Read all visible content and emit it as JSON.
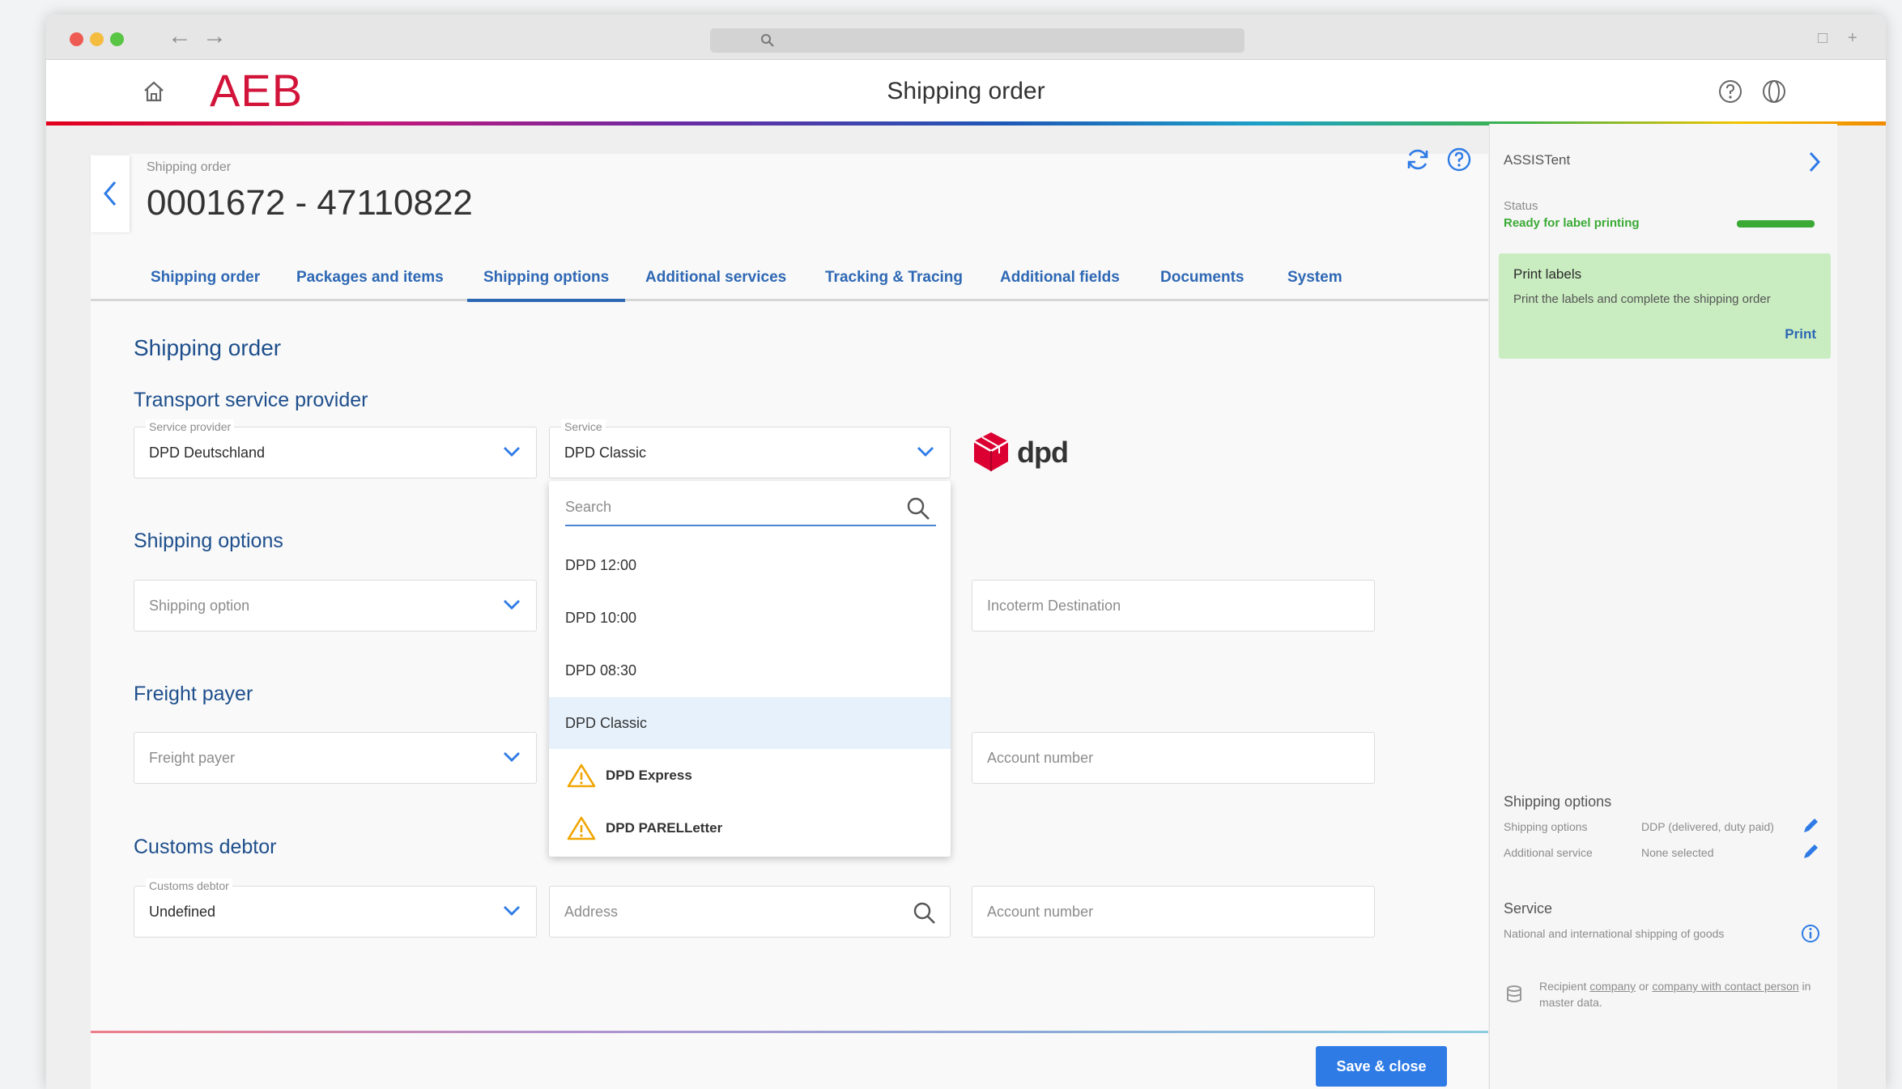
{
  "window": {
    "app_title": "Shipping order",
    "logo_text": "AEB"
  },
  "header": {
    "subtitle": "Shipping order",
    "order_number": "0001672 - 47110822"
  },
  "tabs": [
    {
      "label": "Shipping order"
    },
    {
      "label": "Packages and items"
    },
    {
      "label": "Shipping options",
      "active": true
    },
    {
      "label": "Additional services"
    },
    {
      "label": "Tracking & Tracing"
    },
    {
      "label": "Additional fields"
    },
    {
      "label": "Documents"
    },
    {
      "label": "System"
    }
  ],
  "form": {
    "section_title": "Shipping order",
    "transport": {
      "title": "Transport service provider",
      "provider_label": "Service provider",
      "provider_value": "DPD Deutschland",
      "service_label": "Service",
      "service_value": "DPD Classic",
      "carrier_logo": "dpd"
    },
    "shipping_options": {
      "title": "Shipping options",
      "option_placeholder": "Shipping option",
      "incoterm_placeholder": "Incoterm Destination"
    },
    "freight_payer": {
      "title": "Freight payer",
      "payer_placeholder": "Freight payer",
      "account_placeholder": "Account number"
    },
    "customs_debtor": {
      "title": "Customs debtor",
      "debtor_label": "Customs debtor",
      "debtor_value": "Undefined",
      "address_placeholder": "Address",
      "account_placeholder": "Account number"
    },
    "save_label": "Save & close"
  },
  "service_dropdown": {
    "search_placeholder": "Search",
    "options": [
      {
        "label": "DPD 12:00",
        "warning": false,
        "selected": false
      },
      {
        "label": "DPD 10:00",
        "warning": false,
        "selected": false
      },
      {
        "label": "DPD 08:30",
        "warning": false,
        "selected": false
      },
      {
        "label": "DPD Classic",
        "warning": false,
        "selected": true
      },
      {
        "label": "DPD Express",
        "warning": true,
        "selected": false
      },
      {
        "label": "DPD PARELLetter",
        "warning": true,
        "selected": false
      }
    ]
  },
  "assistant": {
    "title": "ASSISTent",
    "status_label": "Status",
    "status_value": "Ready for label printing",
    "status_progress": 1.0,
    "print_card": {
      "title": "Print labels",
      "description": "Print the labels and complete the shipping order",
      "action": "Print"
    },
    "shipping_options": {
      "title": "Shipping options",
      "rows": [
        {
          "key": "Shipping options",
          "value": "DDP (delivered, duty paid)"
        },
        {
          "key": "Additional service",
          "value": "None selected"
        }
      ]
    },
    "service": {
      "title": "Service",
      "description": "National and international shipping of goods"
    },
    "note": {
      "prefix": "Recipient",
      "link1": "company",
      "middle": "or",
      "link2": "company with contact person",
      "suffix": "in master data."
    }
  },
  "colors": {
    "accent": "#2e68b4",
    "brand": "#d2143a",
    "success": "#3aaa35",
    "button": "#2e7be6",
    "selected_row": "#e6f1fb",
    "print_card": "#c9ecc0"
  }
}
